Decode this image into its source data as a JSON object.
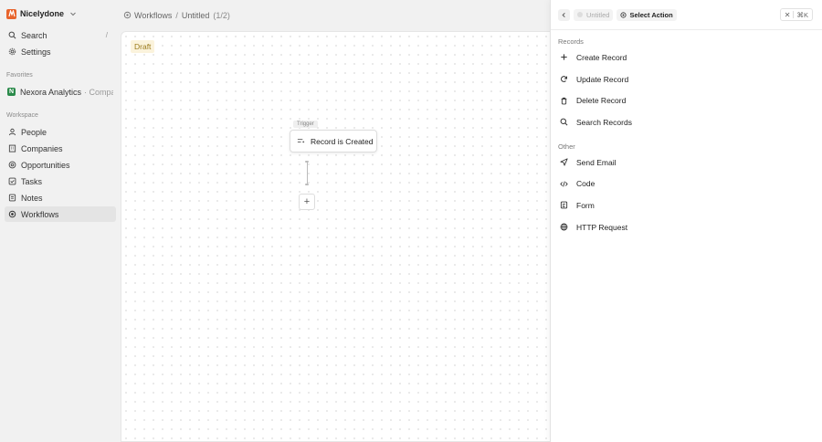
{
  "workspace": {
    "name": "Nicelydone"
  },
  "sidebar": {
    "search": {
      "label": "Search",
      "shortcut": "/"
    },
    "settings": {
      "label": "Settings"
    },
    "favorites_label": "Favorites",
    "favorite": {
      "badge": "N",
      "name": "Nexora Analytics",
      "sub": "· Compan"
    },
    "workspace_label": "Workspace",
    "items": [
      {
        "label": "People"
      },
      {
        "label": "Companies"
      },
      {
        "label": "Opportunities"
      },
      {
        "label": "Tasks"
      },
      {
        "label": "Notes"
      },
      {
        "label": "Workflows"
      }
    ]
  },
  "breadcrumb": {
    "root": "Workflows",
    "sep": "/",
    "current": "Untitled",
    "count": "(1/2)"
  },
  "canvas": {
    "status": "Draft",
    "trigger_tag": "Trigger",
    "trigger_label": "Record is Created",
    "add_label": "+"
  },
  "panel": {
    "crumb_untitled": "Untitled",
    "crumb_action": "Select Action",
    "close_shortcut": "⌘K",
    "close_glyph": "✕",
    "groups": [
      {
        "label": "Records",
        "actions": [
          {
            "label": "Create Record",
            "icon": "plus-icon"
          },
          {
            "label": "Update Record",
            "icon": "refresh-icon"
          },
          {
            "label": "Delete Record",
            "icon": "trash-icon"
          },
          {
            "label": "Search Records",
            "icon": "search-icon"
          }
        ]
      },
      {
        "label": "Other",
        "actions": [
          {
            "label": "Send Email",
            "icon": "send-icon"
          },
          {
            "label": "Code",
            "icon": "code-icon"
          },
          {
            "label": "Form",
            "icon": "form-icon"
          },
          {
            "label": "HTTP Request",
            "icon": "globe-icon"
          }
        ]
      }
    ]
  },
  "colors": {
    "brand": "#e8642c",
    "favorite_badge": "#2a8a4a",
    "draft_bg": "#fbf3dc",
    "draft_text": "#9a7a1a"
  }
}
